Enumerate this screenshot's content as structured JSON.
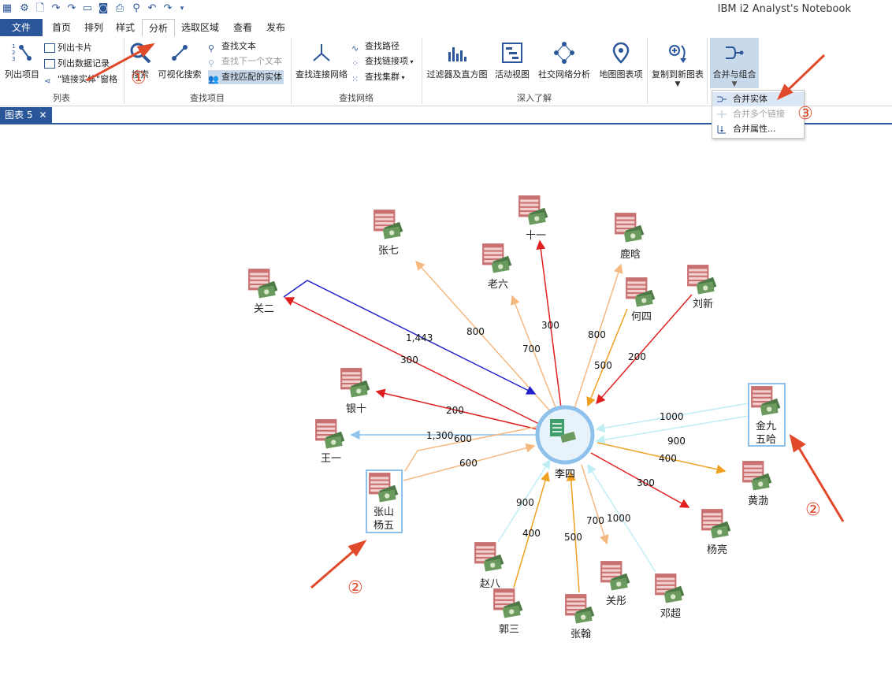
{
  "app": {
    "title": "IBM i2 Analyst's Notebook"
  },
  "quick_access": [
    "app-icon",
    "gear-icon",
    "new-file-icon",
    "redo-link-icon",
    "link-icon",
    "folder-icon",
    "camera-icon",
    "print-icon",
    "search-icon",
    "undo-icon",
    "redo-icon",
    "customize-dropdown-icon"
  ],
  "tabs": {
    "file": "文件",
    "home": "首页",
    "arrange": "排列",
    "style": "样式",
    "analyze": "分析",
    "select": "选取区域",
    "view": "查看",
    "publish": "发布"
  },
  "ribbon": {
    "list_items": "列出项目",
    "list_cards": "列出卡片",
    "list_records": "列出数据记录",
    "link_pane": "\"链接实体\"窗格",
    "group_list": "列表",
    "search": "搜索",
    "visual_search": "可视化搜索",
    "find_text": "查找文本",
    "find_next": "查找下一个文本",
    "find_matching": "查找匹配的实体",
    "group_find_items": "查找项目",
    "find_connecting": "查找连接网络",
    "find_path": "查找路径",
    "find_linked": "查找链接项",
    "find_clusters": "查找集群",
    "group_find_network": "查找网络",
    "filters_histograms": "过滤器及直方图",
    "activity_views": "活动视图",
    "sna": "社交网络分析",
    "map_items": "地图图表项",
    "copy_to_new": "复制到新图表",
    "group_deep": "深入了解",
    "merge_combine": "合并与组合"
  },
  "doc_tab": {
    "label": "图表 5",
    "close": "✕"
  },
  "dropdown": {
    "merge_entities": "合并实体",
    "merge_links": "合并多个链接",
    "merge_attributes": "合并属性..."
  },
  "annotations": {
    "one": "①",
    "two": "②",
    "three": "③"
  },
  "chart": {
    "center": "李四",
    "entities": {
      "shiyi": "十一",
      "zhangqi": "张七",
      "luhan": "鹿晗",
      "laoliu": "老六",
      "hesi": "何四",
      "liuxin": "刘新",
      "guaner": "关二",
      "yinshi": "银十",
      "wangyi": "王一",
      "zhangshan_1": "张山",
      "zhangshan_2": "杨五",
      "jinjiu_1": "金九",
      "jinjiu_2": "五哈",
      "huangbo": "黄渤",
      "yangliang": "杨亮",
      "zhaoba": "赵八",
      "guosan": "郭三",
      "zhanghan": "张翰",
      "guantong": "关彤",
      "dengchao": "邓超"
    },
    "links": {
      "l_zhangqi": "800",
      "l_laoliu": "700",
      "l_shiyi": "300",
      "l_luhan": "800",
      "l_hesi": "500",
      "l_liuxin": "200",
      "l_guaner_blue": "1,443",
      "l_guaner": "300",
      "l_yinshi": "200",
      "l_wangyi": "1,300",
      "l_zhangshan_a": "600",
      "l_zhangshan_b": "600",
      "l_jinjiu_a": "1000",
      "l_jinjiu_b": "900",
      "l_huangbo": "400",
      "l_yangliang": "300",
      "l_zhaoba": "900",
      "l_guosan": "400",
      "l_zhanghan": "500",
      "l_guantong": "700",
      "l_dengchao": "1000"
    }
  }
}
